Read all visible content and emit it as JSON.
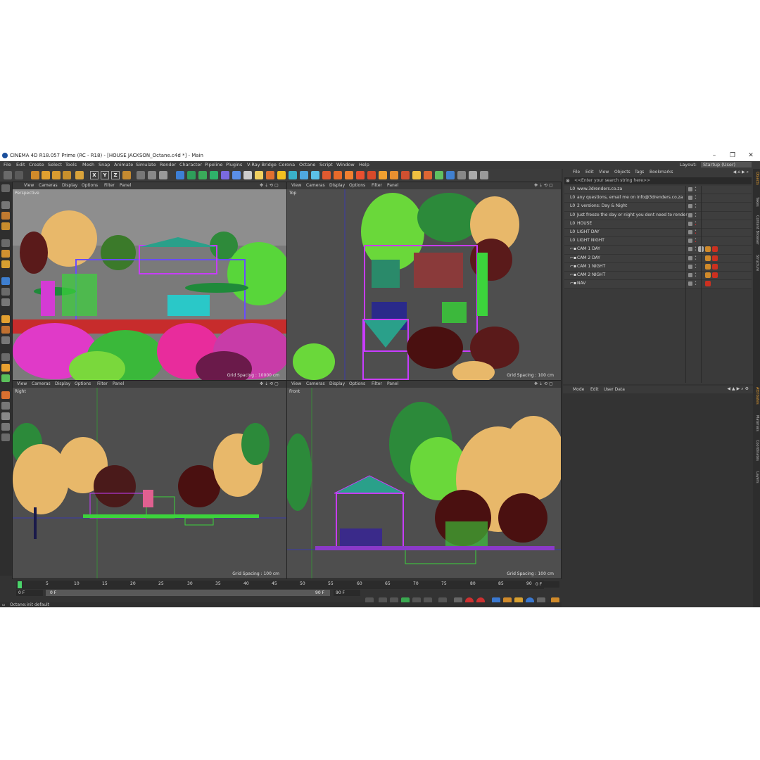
{
  "window": {
    "title": "CINEMA 4D R18.057 Prime (RC - R18) - [HOUSE JACKSON_Octane.c4d *] - Main",
    "minimize": "–",
    "maximize": "❐",
    "close": "✕"
  },
  "menu": [
    "File",
    "Edit",
    "Create",
    "Select",
    "Tools",
    "Mesh",
    "Snap",
    "Animate",
    "Simulate",
    "Render",
    "Character",
    "Pipeline",
    "Plugins",
    "V-Ray Bridge",
    "Corona",
    "Octane",
    "Script",
    "Window",
    "Help"
  ],
  "layout": {
    "label": "Layout:",
    "value": "Startup (User)"
  },
  "toolbar_letters": [
    "X",
    "Y",
    "Z"
  ],
  "viewport_menu": [
    "View",
    "Cameras",
    "Display",
    "Options",
    "Filter",
    "Panel"
  ],
  "viewports": [
    {
      "label": "Perspective",
      "grid": "Grid Spacing : 10000 cm"
    },
    {
      "label": "Top",
      "grid": "Grid Spacing : 100 cm"
    },
    {
      "label": "Right",
      "grid": "Grid Spacing : 100 cm"
    },
    {
      "label": "Front",
      "grid": "Grid Spacing : 100 cm"
    }
  ],
  "objects": {
    "menu": [
      "File",
      "Edit",
      "View",
      "Objects",
      "Tags",
      "Bookmarks"
    ],
    "search_placeholder": "<<Enter your search string here>>",
    "items": [
      {
        "icon": "L0",
        "name": "www.3drenders.co.za"
      },
      {
        "icon": "L0",
        "name": "any questions, email me on info@3drenders.co.za"
      },
      {
        "icon": "L0",
        "name": "2 versions: Day & Night"
      },
      {
        "icon": "L0",
        "name": "Just freeze the day or night you dont need to render"
      },
      {
        "icon": "L0",
        "name": "HOUSE"
      },
      {
        "icon": "L0",
        "name": "LIGHT DAY"
      },
      {
        "icon": "L0",
        "name": "LIGHT NIGHT"
      },
      {
        "icon": "cam",
        "name": "CAM 1 DAY"
      },
      {
        "icon": "cam",
        "name": "CAM 2 DAY"
      },
      {
        "icon": "cam",
        "name": "CAM 1 NIGHT"
      },
      {
        "icon": "cam",
        "name": "CAM 2 NIGHT"
      },
      {
        "icon": "cam",
        "name": "NAV"
      }
    ]
  },
  "attributes": {
    "menu": [
      "Mode",
      "Edit",
      "User Data"
    ]
  },
  "side_tabs_top": [
    "Objects",
    "Takes",
    "Content Browser",
    "Structure"
  ],
  "side_tabs_bottom": [
    "Attributes",
    "Materials",
    "Coordinates",
    "Layers"
  ],
  "timeline": {
    "ticks": [
      "0",
      "5",
      "10",
      "15",
      "20",
      "25",
      "30",
      "35",
      "40",
      "45",
      "50",
      "55",
      "60",
      "65",
      "70",
      "75",
      "80",
      "85",
      "90"
    ],
    "current_frame": "0 F",
    "start": "0 F",
    "slider_start": "0 F",
    "slider_end": "90 F",
    "end": "90 F",
    "end_field": "0 F"
  },
  "status": "Octane:init default"
}
